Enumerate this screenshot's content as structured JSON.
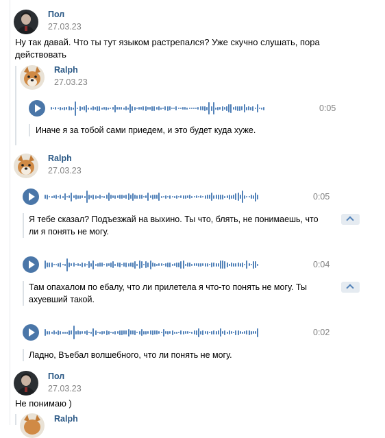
{
  "messages": [
    {
      "author": "Пол",
      "date": "27.03.23",
      "text_line1": "Ну так давай. Что ты тут языком растрепался? Уже скучно слушать, пора",
      "text_line2": "действовать"
    },
    {
      "author": "Ralph",
      "date": "27.03.23",
      "voice": {
        "duration": "0:05",
        "transcript": "Иначе я за тобой сами приедем, и это будет куда хуже."
      }
    },
    {
      "author": "Ralph",
      "date": "27.03.23",
      "voices": [
        {
          "duration": "0:05",
          "transcript_line1": "Я тебе сказал? Подъезжай на выхино. Ты что, блять, не понимаешь, что",
          "transcript_line2": "ли я понять не могу."
        },
        {
          "duration": "0:04",
          "transcript_line1": "Там опахалом по ебалу, что ли прилетела я что-то понять не могу. Ты",
          "transcript_line2": "ахуевший такой."
        },
        {
          "duration": "0:02",
          "transcript_line1": "Ладно, Въебал волшебного, что ли понять не могу."
        }
      ]
    },
    {
      "author": "Пол",
      "date": "27.03.23",
      "text": "Не понимаю )"
    },
    {
      "author": "Ralph"
    }
  ],
  "colors": {
    "accent": "#4a76a8",
    "name": "#2a5885",
    "muted": "#828282"
  },
  "icons": {
    "play": "play-icon",
    "collapse": "chevron-up-icon"
  }
}
